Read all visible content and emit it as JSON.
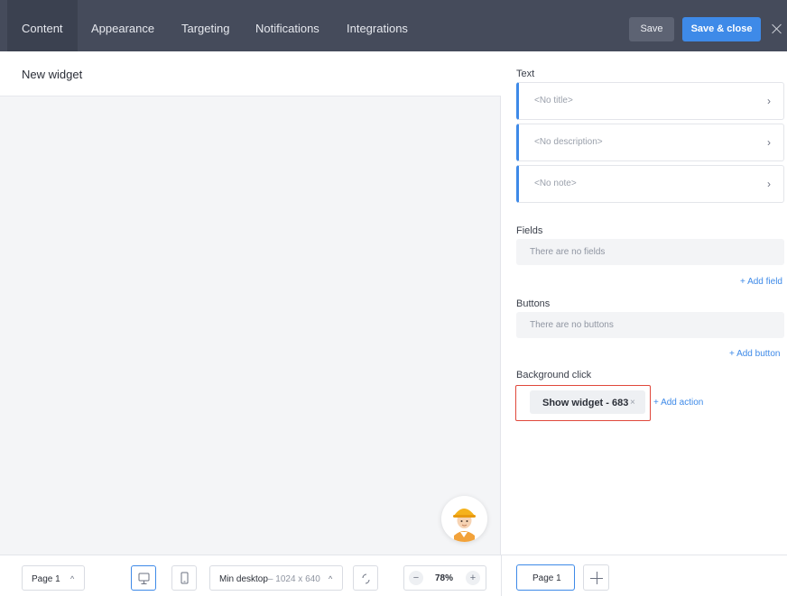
{
  "header": {
    "tabs": [
      {
        "label": "Content"
      },
      {
        "label": "Appearance"
      },
      {
        "label": "Targeting"
      },
      {
        "label": "Notifications"
      },
      {
        "label": "Integrations"
      }
    ],
    "save_label": "Save",
    "save_close_label": "Save & close"
  },
  "canvas": {
    "widget_title": "New widget"
  },
  "panel": {
    "text_label": "Text",
    "text_items": [
      {
        "placeholder": "<No title>"
      },
      {
        "placeholder": "<No description>"
      },
      {
        "placeholder": "<No note>"
      }
    ],
    "fields_label": "Fields",
    "fields_empty": "There are no fields",
    "add_field": "+ Add field",
    "buttons_label": "Buttons",
    "buttons_empty": "There are no buttons",
    "add_button": "+ Add button",
    "bg_click_label": "Background click",
    "action_chip": "Show widget - 683",
    "action_chip_remove": "×",
    "add_action": "+ Add action"
  },
  "bottom": {
    "page_selector": "Page 1",
    "viewport_name": "Min desktop",
    "viewport_size": "– 1024 x 640",
    "zoom_minus": "−",
    "zoom_value": "78%",
    "zoom_plus": "+",
    "page_tab": "Page 1",
    "caret": "^"
  },
  "colors": {
    "topbar": "#454b5b",
    "accent": "#3e8ae8",
    "highlight_border": "#e0483b"
  }
}
